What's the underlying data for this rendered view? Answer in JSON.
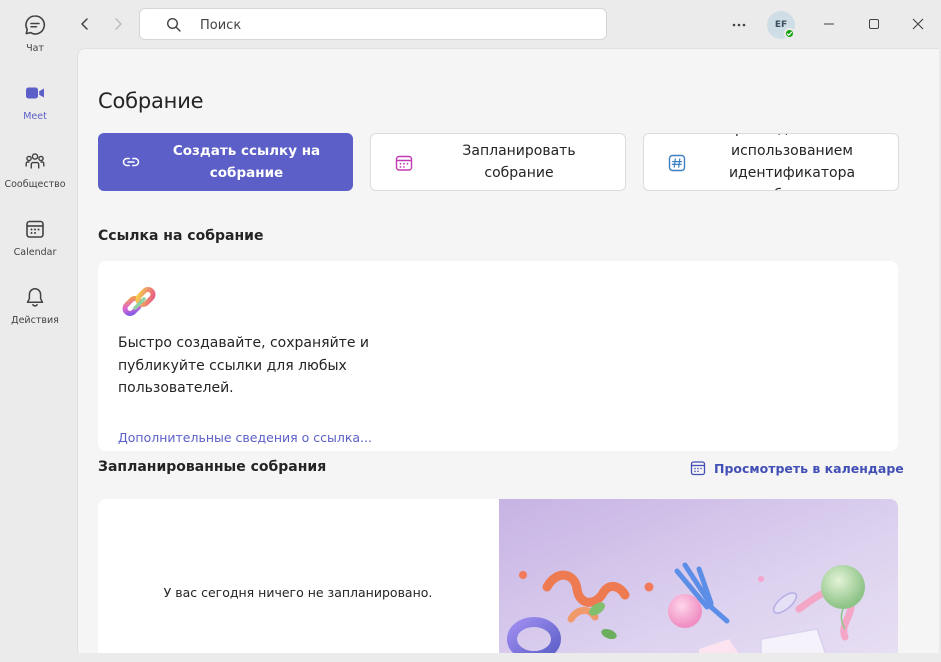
{
  "rail": {
    "items": [
      {
        "label": "Чат",
        "icon": "chat-icon"
      },
      {
        "label": "Meet",
        "icon": "video-camera-icon",
        "active": true
      },
      {
        "label": "Сообщество",
        "icon": "community-icon"
      },
      {
        "label": "Calendar",
        "icon": "calendar-icon"
      },
      {
        "label": "Действия",
        "icon": "bell-icon"
      }
    ]
  },
  "topbar": {
    "search_placeholder": "Поиск",
    "avatar_initials": "EF"
  },
  "main": {
    "title": "Собрание",
    "actions": {
      "create_link": "Создать ссылку на собрание",
      "schedule": "Запланировать собрание",
      "join_by_id": "Присоединиться с использованием идентификатора собрания"
    },
    "link_section": {
      "title": "Ссылка на собрание",
      "description": "Быстро создавайте, сохраняйте и публикуйте ссылки для любых пользователей.",
      "more_link": "Дополнительные сведения о ссылка..."
    },
    "scheduled_section": {
      "title": "Запланированные собрания",
      "calendar_link": "Просмотреть в календаре",
      "empty_text": "У вас сегодня ничего не запланировано."
    }
  },
  "colors": {
    "accent": "#5b5fc7",
    "link": "#424fb6",
    "presence": "#13a10e"
  }
}
